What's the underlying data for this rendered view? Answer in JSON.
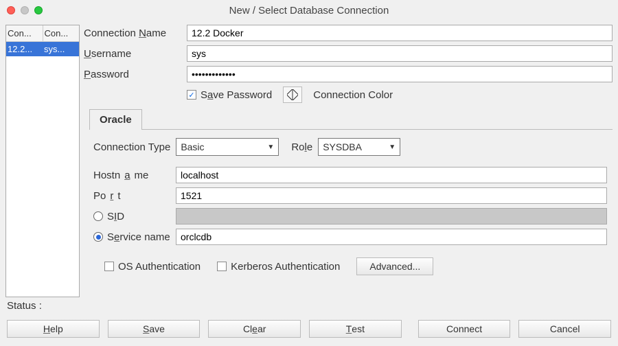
{
  "window": {
    "title": "New / Select Database Connection"
  },
  "connList": {
    "headers": [
      "Con...",
      "Con..."
    ],
    "rows": [
      {
        "name": "12.2...",
        "user": "sys...",
        "selected": true
      }
    ]
  },
  "form": {
    "connectionNameLabel": "Connection Name",
    "connectionName": "12.2 Docker",
    "usernameLabel": "Username",
    "username": "sys",
    "passwordLabel": "Password",
    "password": "•••••••••••••",
    "savePasswordLabel": "Save Password",
    "savePasswordChecked": true,
    "connectionColorLabel": "Connection Color"
  },
  "tabs": {
    "oracle": "Oracle"
  },
  "oracle": {
    "connectionTypeLabel": "Connection Type",
    "connectionType": "Basic",
    "roleLabel": "Role",
    "role": "SYSDBA",
    "hostnameLabel": "Hostname",
    "hostname": "localhost",
    "portLabel": "Port",
    "port": "1521",
    "sidLabel": "SID",
    "sid": "",
    "serviceNameLabel": "Service name",
    "serviceName": "orclcdb",
    "sidSelected": false,
    "serviceSelected": true,
    "osAuthLabel": "OS Authentication",
    "kerberosLabel": "Kerberos Authentication",
    "advancedLabel": "Advanced..."
  },
  "statusLabel": "Status :",
  "buttons": {
    "help": "Help",
    "save": "Save",
    "clear": "Clear",
    "test": "Test",
    "connect": "Connect",
    "cancel": "Cancel"
  }
}
